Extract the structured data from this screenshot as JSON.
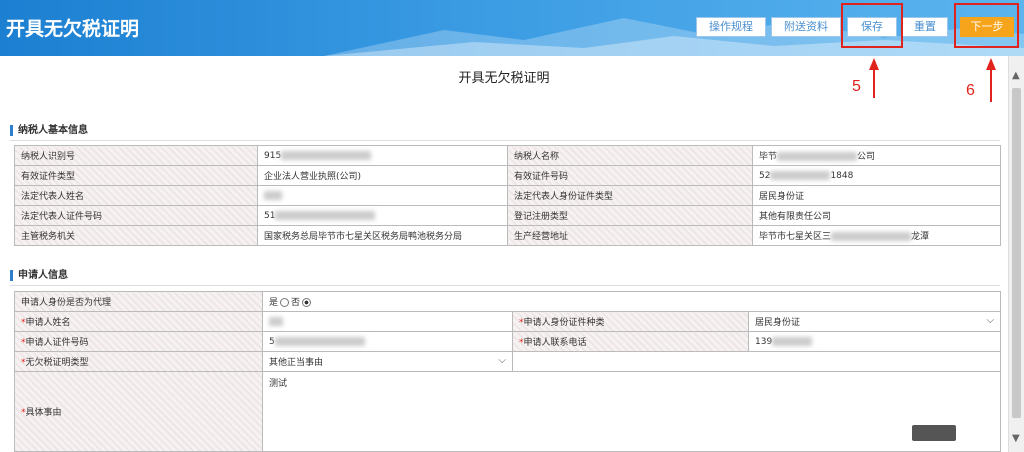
{
  "header": {
    "title": "开具无欠税证明",
    "buttons": [
      "操作规程",
      "附送资料",
      "保存",
      "重置",
      "下一步"
    ]
  },
  "annotations": {
    "n5": "5",
    "n6": "6"
  },
  "page_heading": "开具无欠税证明",
  "taxpayer_section": {
    "title": "纳税人基本信息",
    "rows": [
      [
        "纳税人识别号",
        "915",
        "纳税人名称",
        "毕节",
        "公司"
      ],
      [
        "有效证件类型",
        "企业法人营业执照(公司)",
        "有效证件号码",
        "52",
        "1848"
      ],
      [
        "法定代表人姓名",
        "",
        "法定代表人身份证件类型",
        "居民身份证",
        ""
      ],
      [
        "法定代表人证件号码",
        "51",
        "登记注册类型",
        "其他有限责任公司",
        ""
      ],
      [
        "主管税务机关",
        "国家税务总局毕节市七星关区税务局鸭池税务分局",
        "生产经营地址",
        "毕节市七星关区三",
        "龙潭"
      ]
    ]
  },
  "applicant_section": {
    "title": "申请人信息",
    "is_agent_label": "申请人身份是否为代理",
    "yes": "是",
    "no": "否",
    "name_label": "申请人姓名",
    "id_type_label": "申请人身份证件种类",
    "id_type_value": "居民身份证",
    "id_no_label": "申请人证件号码",
    "id_no_prefix": "5",
    "phone_label": "申请人联系电话",
    "phone_prefix": "139",
    "cert_type_label": "无欠税证明类型",
    "cert_type_value": "其他正当事由",
    "reason_label": "具体事由",
    "reason_value": "测试",
    "required_mark": "*"
  },
  "colors": {
    "header": "#1c7fd1",
    "accent_orange": "#f6a41b",
    "annotation_red": "#e0231c"
  }
}
